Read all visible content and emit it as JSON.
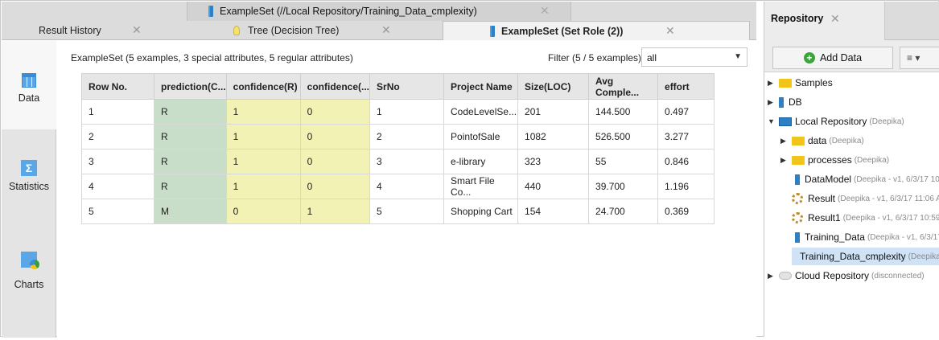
{
  "doc_tabs": {
    "top": {
      "label": "ExampleSet (//Local Repository/Training_Data_cmplexity)"
    },
    "row2": [
      {
        "label": "Result History"
      },
      {
        "label": "Tree (Decision Tree)"
      },
      {
        "label": "ExampleSet (Set Role (2))"
      }
    ]
  },
  "left_nav": [
    {
      "label": "Data",
      "icon": "table-icon"
    },
    {
      "label": "Statistics",
      "icon": "statistics-icon"
    },
    {
      "label": "Charts",
      "icon": "charts-icon"
    }
  ],
  "main": {
    "summary": "ExampleSet (5 examples, 3 special attributes, 5 regular attributes)",
    "filter_label": "Filter (5 / 5 examples):",
    "filter_value": "all"
  },
  "table": {
    "headers": [
      "Row No.",
      "prediction(C...",
      "confidence(R)",
      "confidence(...",
      "SrNo",
      "Project Name",
      "Size(LOC)",
      "Avg Comple...",
      "effort"
    ],
    "rows": [
      [
        "1",
        "R",
        "1",
        "0",
        "1",
        "CodeLevelSe...",
        "201",
        "144.500",
        "0.497"
      ],
      [
        "2",
        "R",
        "1",
        "0",
        "2",
        "PointofSale",
        "1082",
        "526.500",
        "3.277"
      ],
      [
        "3",
        "R",
        "1",
        "0",
        "3",
        "e-library",
        "323",
        "55",
        "0.846"
      ],
      [
        "4",
        "R",
        "1",
        "0",
        "4",
        "Smart File Co...",
        "440",
        "39.700",
        "1.196"
      ],
      [
        "5",
        "M",
        "0",
        "1",
        "5",
        "Shopping Cart",
        "154",
        "24.700",
        "0.369"
      ]
    ]
  },
  "repository": {
    "tab_label": "Repository",
    "add_label": "Add Data",
    "menu_label": "≡ ▾",
    "items": [
      {
        "label": "Samples",
        "meta": ""
      },
      {
        "label": "DB",
        "meta": ""
      },
      {
        "label": "Local Repository",
        "meta": "(Deepika)"
      },
      {
        "label": "data",
        "meta": "(Deepika)"
      },
      {
        "label": "processes",
        "meta": "(Deepika)"
      },
      {
        "label": "DataModel",
        "meta": "(Deepika - v1, 6/3/17 10:"
      },
      {
        "label": "Result",
        "meta": "(Deepika - v1, 6/3/17 11:06 A"
      },
      {
        "label": "Result1",
        "meta": "(Deepika - v1, 6/3/17 10:59"
      },
      {
        "label": "Training_Data",
        "meta": "(Deepika - v1, 6/3/17"
      },
      {
        "label": "Training_Data_cmplexity",
        "meta": "(Deepika"
      },
      {
        "label": "Cloud Repository",
        "meta": "(disconnected)"
      }
    ]
  }
}
